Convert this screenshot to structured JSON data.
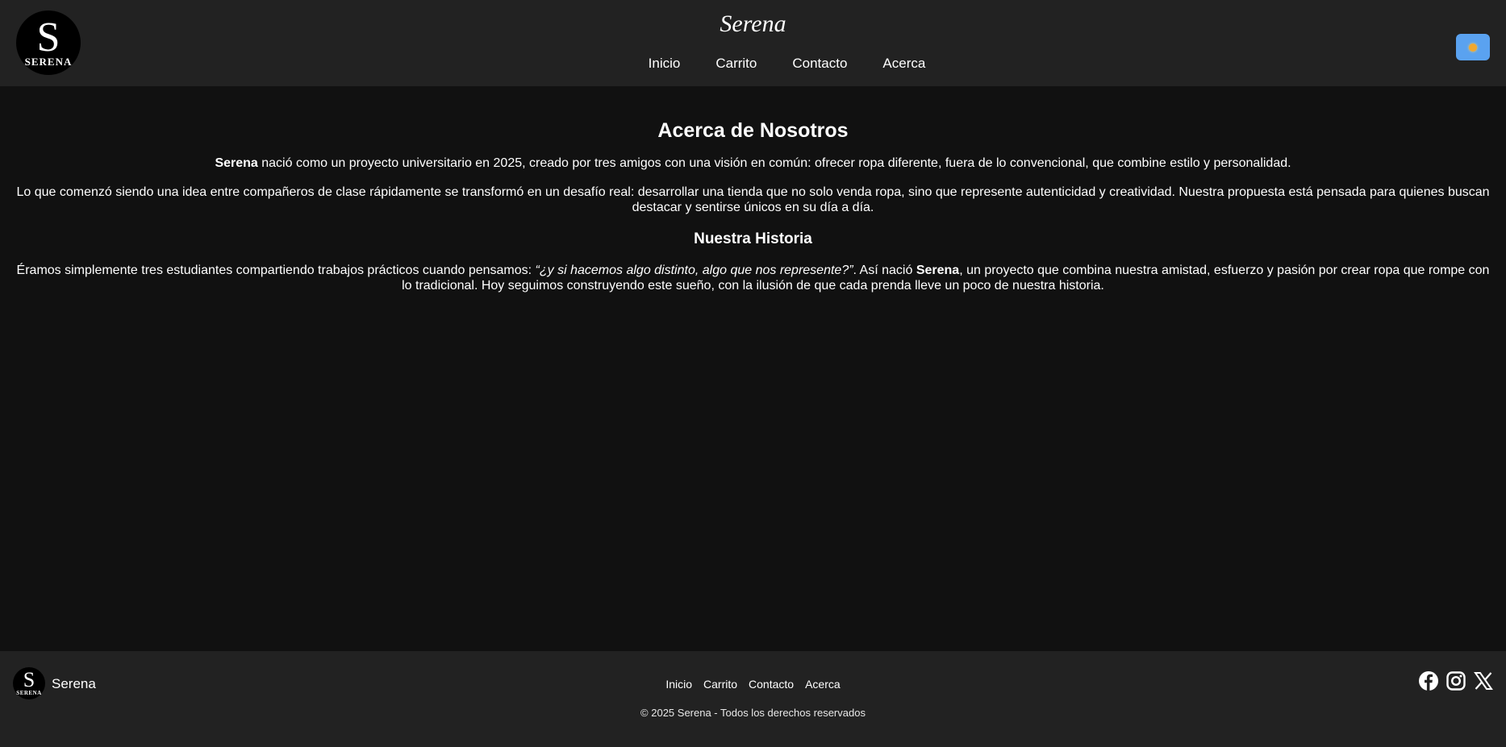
{
  "header": {
    "logo": {
      "letter": "S",
      "word": "SERENA"
    },
    "brand": "Serena",
    "nav": [
      "Inicio",
      "Carrito",
      "Contacto",
      "Acerca"
    ],
    "theme_toggle_icon": "sun-icon"
  },
  "about": {
    "title": "Acerca de Nosotros",
    "p1_bold": "Serena",
    "p1_rest": " nació como un proyecto universitario en 2025, creado por tres amigos con una visión en común: ofrecer ropa diferente, fuera de lo convencional, que combine estilo y personalidad.",
    "p2": "Lo que comenzó siendo una idea entre compañeros de clase rápidamente se transformó en un desafío real: desarrollar una tienda que no solo venda ropa, sino que represente autenticidad y creatividad. Nuestra propuesta está pensada para quienes buscan destacar y sentirse únicos en su día a día.",
    "history_title": "Nuestra Historia",
    "p3_a": "Éramos simplemente tres estudiantes compartiendo trabajos prácticos cuando pensamos: ",
    "p3_quote": "“¿y si hacemos algo distinto, algo que nos represente?”",
    "p3_b": ". Así nació ",
    "p3_bold": "Serena",
    "p3_c": ", un proyecto que combina nuestra amistad, esfuerzo y pasión por crear ropa que rompe con lo tradicional. Hoy seguimos construyendo este sueño, con la ilusión de que cada prenda lleve un poco de nuestra historia."
  },
  "footer": {
    "logo": {
      "letter": "S",
      "word": "SERENA"
    },
    "brand": "Serena",
    "nav": [
      "Inicio",
      "Carrito",
      "Contacto",
      "Acerca"
    ],
    "copyright": "© 2025 Serena - Todos los derechos reservados",
    "social_icons": [
      "facebook-icon",
      "instagram-icon",
      "x-icon"
    ]
  },
  "colors": {
    "background": "#111111",
    "header_footer": "#222222",
    "theme_button": "#5aa2f0",
    "text": "#ffffff"
  }
}
